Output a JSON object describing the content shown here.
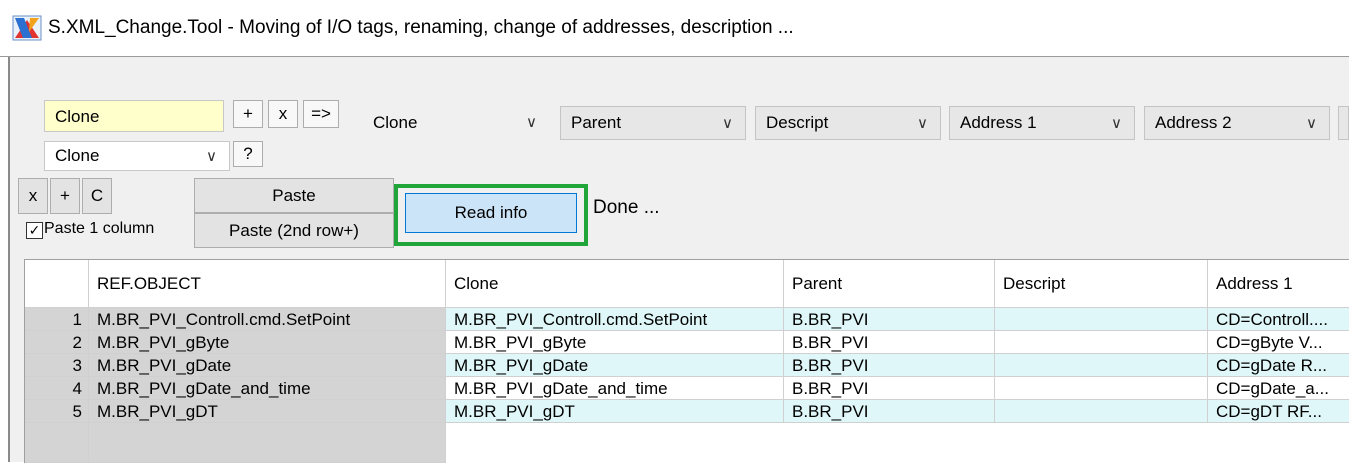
{
  "window": {
    "title": "S.XML_Change.Tool - Moving of I/O tags, renaming, change of addresses, description ..."
  },
  "toolbar": {
    "clone_input_value": "Clone",
    "plus_label": "+",
    "x_label": "x",
    "arrow_label": "=>",
    "clone_select_value": "Clone",
    "help_label": "?",
    "columns": [
      "Clone",
      "Parent",
      "Descript",
      "Address 1",
      "Address 2"
    ],
    "row_x_label": "x",
    "row_plus_label": "+",
    "row_c_label": "C",
    "paste_label": "Paste",
    "paste2_label": "Paste (2nd row+)",
    "paste1col_label": "Paste 1 column",
    "paste1col_checked": true,
    "read_info_label": "Read info",
    "status_text": "Done ...",
    "highlight_color": "#1fa53a"
  },
  "table": {
    "headers": [
      "",
      "REF.OBJECT",
      "Clone",
      "Parent",
      "Descript",
      "Address 1"
    ],
    "rows": [
      [
        "1",
        "M.BR_PVI_Controll.cmd.SetPoint",
        "M.BR_PVI_Controll.cmd.SetPoint",
        "B.BR_PVI",
        "",
        "CD=Controll...."
      ],
      [
        "2",
        "M.BR_PVI_gByte",
        "M.BR_PVI_gByte",
        "B.BR_PVI",
        "",
        "CD=gByte V..."
      ],
      [
        "3",
        "M.BR_PVI_gDate",
        "M.BR_PVI_gDate",
        "B.BR_PVI",
        "",
        "CD=gDate R..."
      ],
      [
        "4",
        "M.BR_PVI_gDate_and_time",
        "M.BR_PVI_gDate_and_time",
        "B.BR_PVI",
        "",
        "CD=gDate_a..."
      ],
      [
        "5",
        "M.BR_PVI_gDT",
        "M.BR_PVI_gDT",
        "B.BR_PVI",
        "",
        "CD=gDT RF..."
      ]
    ]
  }
}
